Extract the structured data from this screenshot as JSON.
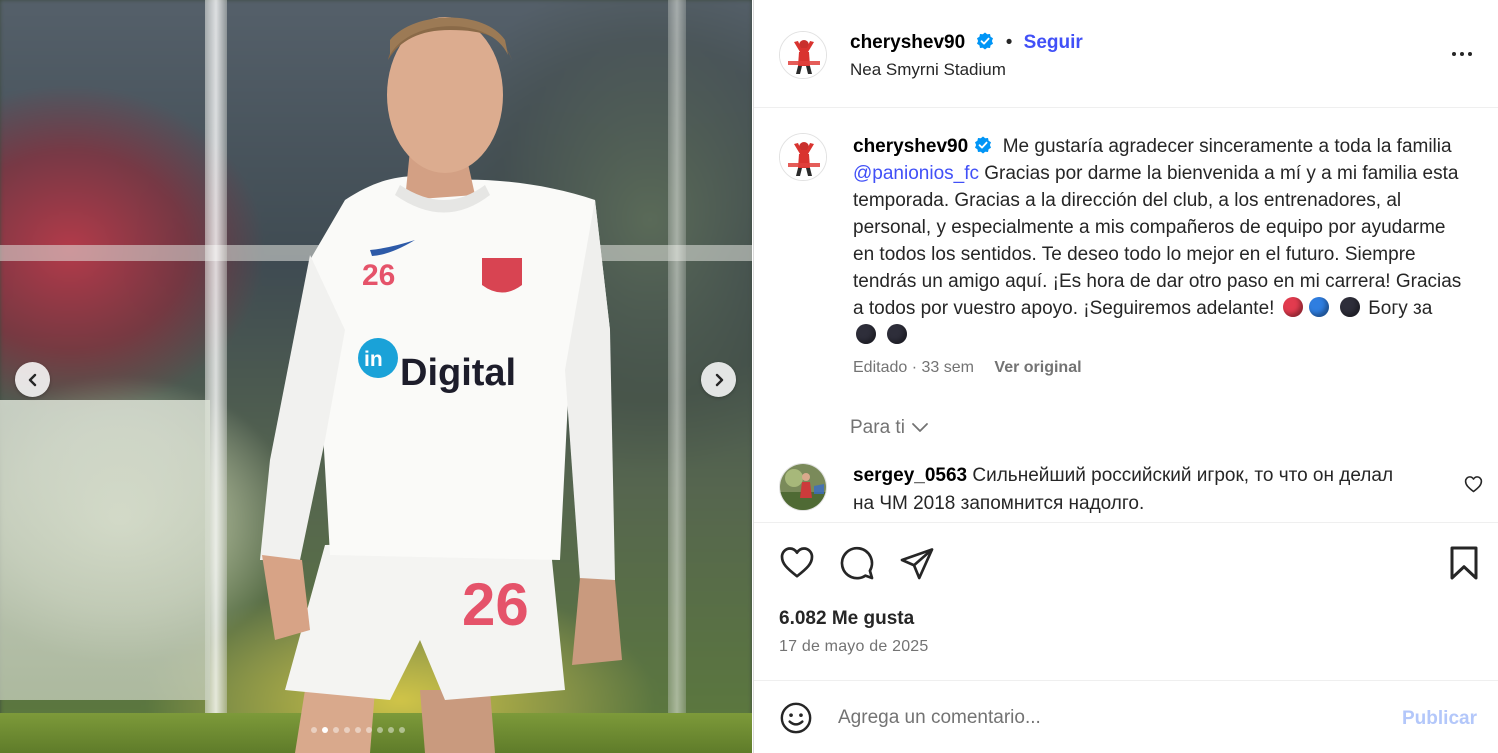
{
  "media": {
    "slides_count": 9,
    "active_slide": 2,
    "prev_icon": "chevron-left-icon",
    "next_icon": "chevron-right-icon",
    "jersey_number": "26",
    "sponsor_in": "in",
    "sponsor_text": "Digital"
  },
  "header": {
    "username": "cheryshev90",
    "separator": "•",
    "follow_label": "Seguir",
    "location": "Nea Smyrni Stadium",
    "more_icon": "more-options-icon"
  },
  "caption": {
    "username": "cheryshev90",
    "text_part1": "Me gustaría agradecer sinceramente a toda la familia ",
    "mention": "@panionios_fc",
    "text_part2": " Gracias por darme la bienvenida a mí y a mi familia esta temporada. Gracias a la dirección del club, a los entrenadores, al personal, y especialmente a mis compañeros de equipo por ayudarme en todos los sentidos. Te deseo todo lo mejor en el futuro. Siempre tendrás un amigo aquí. ¡Es hora de dar otro paso en mi carrera! Gracias a todos por vuestro apoyo. ¡Seguiremos adelante!",
    "text_part3": "Богу за",
    "edited_label": "Editado · 33 sem",
    "see_original": "Ver original"
  },
  "for_you": {
    "label": "Para ti"
  },
  "comments": [
    {
      "username": "sergey_0563",
      "text": "Сильнейший российский игрок, то что он делал на ЧМ 2018 запомнится надолго."
    }
  ],
  "actions": {
    "likes": "6.082 Me gusta",
    "date": "17 de mayo de 2025"
  },
  "comment_box": {
    "placeholder": "Agrega un comentario...",
    "publish_label": "Publicar"
  },
  "colors": {
    "accent_blue": "#4150f7",
    "verified_blue": "#0095f6",
    "publish_disabled": "#b3c7fa",
    "muted_text": "#737373"
  }
}
